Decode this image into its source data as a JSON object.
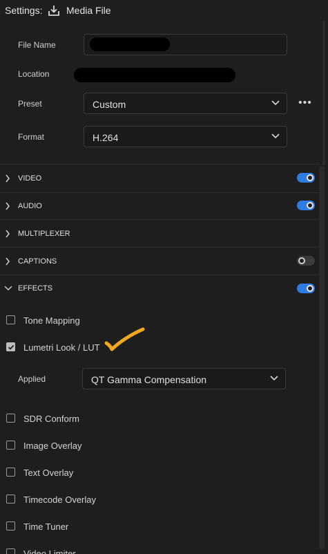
{
  "header": {
    "settings_label": "Settings:",
    "icon": "download-icon",
    "title": "Media File"
  },
  "fields": {
    "file_name_label": "File Name",
    "location_label": "Location",
    "preset_label": "Preset",
    "preset_value": "Custom",
    "format_label": "Format",
    "format_value": "H.264",
    "more_label": "•••"
  },
  "sections": [
    {
      "label": "VIDEO",
      "toggle": "on"
    },
    {
      "label": "AUDIO",
      "toggle": "on"
    },
    {
      "label": "MULTIPLEXER"
    },
    {
      "label": "CAPTIONS",
      "toggle": "off"
    },
    {
      "label": "EFFECTS",
      "toggle": "on",
      "expanded": true
    }
  ],
  "effects": [
    {
      "label": "Tone Mapping",
      "checked": false
    },
    {
      "label": "Lumetri Look / LUT",
      "checked": true
    },
    {
      "label": "SDR Conform",
      "checked": false
    },
    {
      "label": "Image Overlay",
      "checked": false
    },
    {
      "label": "Text Overlay",
      "checked": false
    },
    {
      "label": "Timecode Overlay",
      "checked": false
    },
    {
      "label": "Time Tuner",
      "checked": false
    },
    {
      "label": "Video Limiter",
      "checked": false
    }
  ],
  "applied": {
    "label": "Applied",
    "value": "QT Gamma Compensation"
  },
  "colors": {
    "accent": "#2f7de1",
    "annotation": "#f0a81c",
    "background": "#1e1e1e"
  }
}
